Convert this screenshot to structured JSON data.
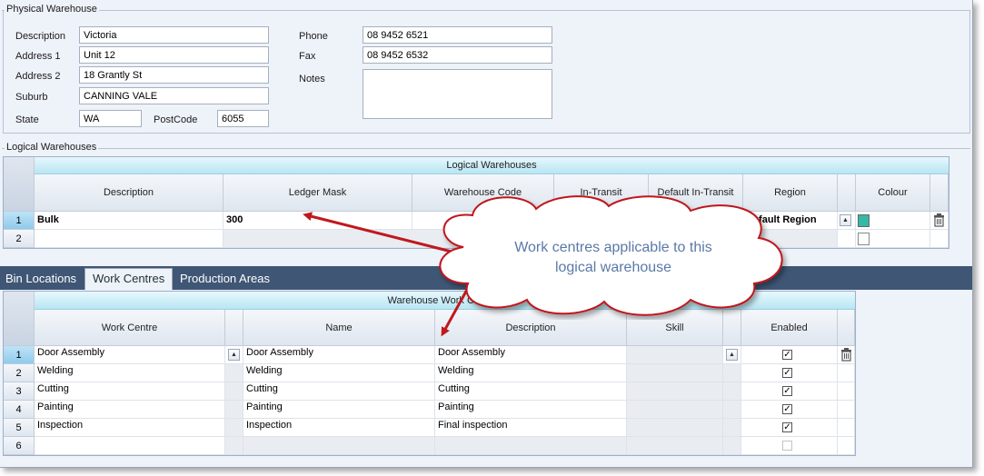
{
  "physical": {
    "group_title": "Physical Warehouse",
    "labels": {
      "description": "Description",
      "address1": "Address 1",
      "address2": "Address 2",
      "suburb": "Suburb",
      "state": "State",
      "postcode": "PostCode",
      "phone": "Phone",
      "fax": "Fax",
      "notes": "Notes"
    },
    "values": {
      "description": "Victoria",
      "address1": "Unit 12",
      "address2": "18 Grantly St",
      "suburb": "CANNING VALE",
      "state": "WA",
      "postcode": "6055",
      "phone": "08 9452 6521",
      "fax": "08 9452 6532",
      "notes": ""
    }
  },
  "logical": {
    "group_title": "Logical Warehouses",
    "band": "Logical Warehouses",
    "columns": [
      "Description",
      "Ledger Mask",
      "Warehouse Code",
      "In-Transit",
      "Default In-Transit",
      "Region",
      "Colour"
    ],
    "rows": [
      {
        "num": "1",
        "description": "Bulk",
        "ledger_mask": "300",
        "region": "Default Region"
      },
      {
        "num": "2",
        "description": "",
        "ledger_mask": "",
        "region": ""
      }
    ],
    "colour_swatch": "#35b8a8"
  },
  "tabs": {
    "items": [
      "Bin Locations",
      "Work Centres",
      "Production Areas"
    ],
    "active": "Work Centres"
  },
  "workcentres": {
    "band": "Warehouse Work Centres",
    "columns": [
      "Work Centre",
      "Name",
      "Description",
      "Skill",
      "Enabled"
    ],
    "rows": [
      {
        "num": "1",
        "work_centre": "Door Assembly",
        "name": "Door Assembly",
        "description": "Door Assembly",
        "enabled": true
      },
      {
        "num": "2",
        "work_centre": "Welding",
        "name": "Welding",
        "description": "Welding",
        "enabled": true
      },
      {
        "num": "3",
        "work_centre": "Cutting",
        "name": "Cutting",
        "description": "Cutting",
        "enabled": true
      },
      {
        "num": "4",
        "work_centre": "Painting",
        "name": "Painting",
        "description": "Painting",
        "enabled": true
      },
      {
        "num": "5",
        "work_centre": "Inspection",
        "name": "Inspection",
        "description": "Final inspection",
        "enabled": true
      },
      {
        "num": "6",
        "work_centre": "",
        "name": "",
        "description": "",
        "enabled": false
      }
    ]
  },
  "callout": {
    "line1": "Work centres applicable to this",
    "line2": "logical warehouse",
    "arrow_color": "#c0181f"
  },
  "icons": {
    "trash": "trash-icon",
    "sort": "sort-up-icon",
    "check": "checkmark"
  }
}
